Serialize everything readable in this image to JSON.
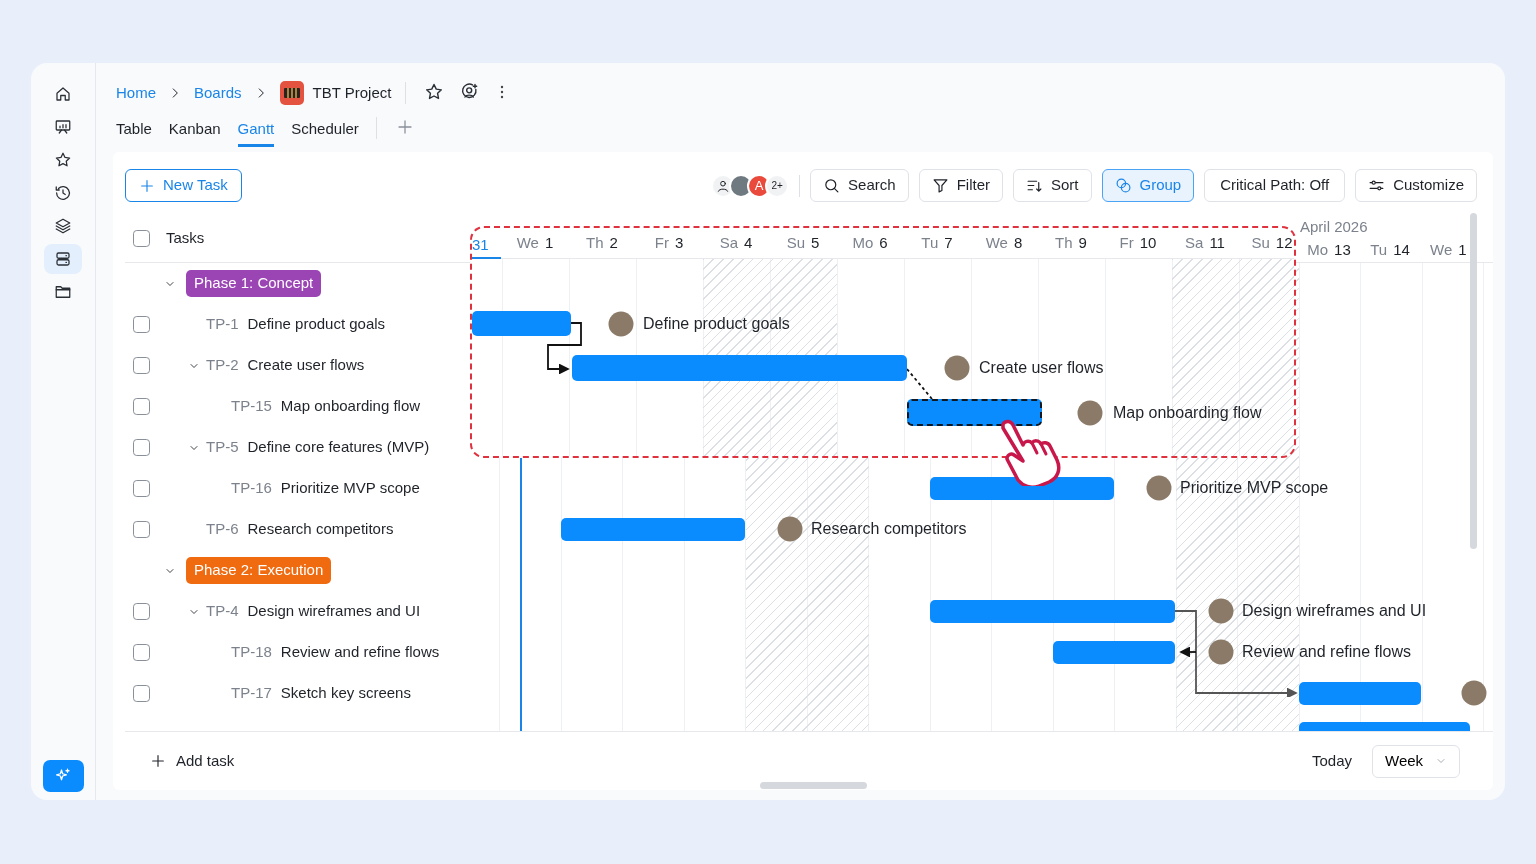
{
  "sidebar": {
    "items": [
      {
        "kind": "home",
        "selected": false
      },
      {
        "kind": "board",
        "selected": false
      },
      {
        "kind": "star",
        "selected": false
      },
      {
        "kind": "history",
        "selected": false
      },
      {
        "kind": "layers",
        "selected": false
      },
      {
        "kind": "storage",
        "selected": true
      },
      {
        "kind": "folder",
        "selected": false
      }
    ]
  },
  "breadcrumb": [
    {
      "label": "Home"
    },
    {
      "label": "Boards"
    }
  ],
  "project": {
    "title": "TBT Project"
  },
  "view_tabs": [
    {
      "label": "Table",
      "selected": false
    },
    {
      "label": "Kanban",
      "selected": false
    },
    {
      "label": "Gantt",
      "selected": true
    },
    {
      "label": "Scheduler",
      "selected": false
    }
  ],
  "toolbar": {
    "new_task": "New Task",
    "avatars": {
      "letter": "A",
      "more": "2+"
    },
    "buttons": [
      {
        "kind": "search",
        "label": "Search",
        "selected": false
      },
      {
        "kind": "filter",
        "label": "Filter",
        "selected": false
      },
      {
        "kind": "sort",
        "label": "Sort",
        "selected": false
      },
      {
        "kind": "group",
        "label": "Group",
        "selected": true
      },
      {
        "kind": "plain",
        "label": "Critical Path: Off",
        "selected": false
      },
      {
        "kind": "customize",
        "label": "Customize",
        "selected": false
      }
    ]
  },
  "task_list": {
    "header": "Tasks",
    "checked": false,
    "rows": [
      {
        "kind": "phase",
        "label": "Phase 1: Concept",
        "color": "#9b45b5",
        "expanded": true,
        "children": [
          {
            "kind": "task",
            "key": "TP-1",
            "title": "Define product goals",
            "checked": false
          },
          {
            "kind": "task",
            "key": "TP-2",
            "title": "Create user flows",
            "checked": false,
            "expanded": true,
            "children": [
              {
                "kind": "task",
                "key": "TP-15",
                "title": "Map onboarding flow",
                "checked": false
              }
            ]
          },
          {
            "kind": "task",
            "key": "TP-5",
            "title": "Define core features (MVP)",
            "checked": false,
            "expanded": true,
            "children": [
              {
                "kind": "task",
                "key": "TP-16",
                "title": "Prioritize MVP scope",
                "checked": false
              }
            ]
          },
          {
            "kind": "task",
            "key": "TP-6",
            "title": "Research competitors",
            "checked": false
          }
        ]
      },
      {
        "kind": "phase",
        "label": "Phase 2: Execution",
        "color": "#f06a10",
        "expanded": true,
        "children": [
          {
            "kind": "task",
            "key": "TP-4",
            "title": "Design wireframes and UI",
            "checked": false,
            "expanded": true,
            "children": [
              {
                "kind": "task",
                "key": "TP-18",
                "title": "Review and refine flows",
                "checked": false
              },
              {
                "kind": "task",
                "key": "TP-17",
                "title": "Sketch key screens",
                "checked": false
              }
            ]
          }
        ]
      }
    ]
  },
  "timeline": {
    "month": "April 2026",
    "zoom_days": [
      {
        "day": "31",
        "today": true
      },
      {
        "weekday": "We",
        "day": "1",
        "today": false
      },
      {
        "weekday": "Th",
        "day": "2",
        "today": false
      },
      {
        "weekday": "Fr",
        "day": "3",
        "today": false
      },
      {
        "weekday": "Sa",
        "day": "4",
        "today": false
      },
      {
        "weekday": "Su",
        "day": "5",
        "today": false
      },
      {
        "weekday": "Mo",
        "day": "6",
        "today": false
      },
      {
        "weekday": "Tu",
        "day": "7",
        "today": false
      },
      {
        "weekday": "We",
        "day": "8",
        "today": false
      },
      {
        "weekday": "Th",
        "day": "9",
        "today": false
      },
      {
        "weekday": "Fr",
        "day": "10",
        "today": false
      },
      {
        "weekday": "Sa",
        "day": "11",
        "today": false
      },
      {
        "weekday": "Su",
        "day": "12",
        "today": false
      }
    ],
    "days": [
      {
        "weekday": "Mo",
        "day": "13"
      },
      {
        "weekday": "Tu",
        "day": "14"
      },
      {
        "weekday": "We",
        "day": "1"
      }
    ],
    "bars": [
      {
        "label": "Define product goals",
        "selected": false
      },
      {
        "label": "Create user flows",
        "selected": false
      },
      {
        "label": "Map onboarding flow",
        "selected": true
      },
      {
        "label": "Prioritize MVP scope",
        "selected": false
      },
      {
        "label": "Research competitors",
        "selected": false
      },
      {
        "label": "Design wireframes and UI",
        "selected": false
      },
      {
        "label": "Review and refine flows",
        "selected": false
      },
      {
        "selected": false
      },
      {
        "selected": false
      }
    ]
  },
  "footer": {
    "add_task": "Add task",
    "today": "Today",
    "scale": "Week"
  }
}
